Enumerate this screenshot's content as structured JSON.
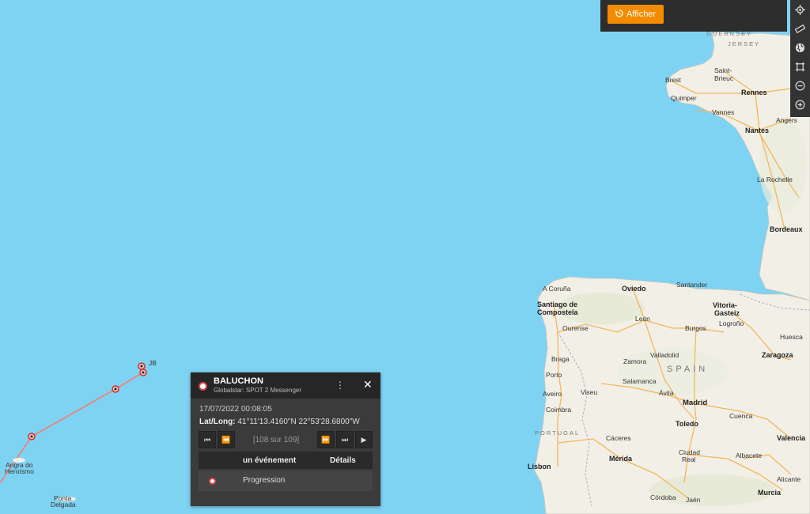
{
  "toolbar": {
    "afficher_label": "Afficher",
    "afficher_icon": "history-icon",
    "accent_color": "#f28b00"
  },
  "map_tools": [
    {
      "name": "locate-icon"
    },
    {
      "name": "ruler-icon"
    },
    {
      "name": "globe-icon"
    },
    {
      "name": "crop-icon"
    },
    {
      "name": "zoom-out-icon"
    },
    {
      "name": "zoom-in-icon"
    }
  ],
  "map": {
    "water_color": "#7fd3f2",
    "land_color": "#f2efe6",
    "track_color": "#e07a7a",
    "places": {
      "guernsey": "GUERNSEY",
      "jersey": "JERSEY",
      "saint_brieuc": "Saint-Brieuc",
      "brest": "Brest",
      "rennes": "Rennes",
      "quimper": "Quimper",
      "vannes": "Vannes",
      "angers": "Angers",
      "nantes": "Nantes",
      "la_rochelle": "La Rochelle",
      "bordeaux": "Bordeaux",
      "a_coruna": "A Coruña",
      "santiago": "Santiago de Compostela",
      "oviedo": "Oviedo",
      "santander": "Santander",
      "vitoria": "Vitoria-Gasteiz",
      "ourense": "Ourense",
      "leon": "León",
      "burgos": "Burgos",
      "logrono": "Logroño",
      "braga": "Braga",
      "porto": "Porto",
      "valladolid": "Valladolid",
      "zamora": "Zamora",
      "huesca": "Huesca",
      "zaragoza": "Zaragoza",
      "aveiro": "Aveiro",
      "viseu": "Viseu",
      "salamanca": "Salamanca",
      "avila": "Ávila",
      "coimbra": "Coimbra",
      "madrid": "Madrid",
      "cuenca": "Cuenca",
      "toledo": "Toledo",
      "valencia": "Valencia",
      "caceres": "Cáceres",
      "lisbon": "Lisbon",
      "merida": "Mérida",
      "ciudad_real": "Ciudad Real",
      "albacete": "Albacete",
      "alicante": "Alicante",
      "murcia": "Murcia",
      "cordoba": "Córdoba",
      "jaen": "Jaén",
      "angra": "Angra do Heroísmo",
      "ponta_delgada": "Ponta Delgada",
      "spain": "SPAIN",
      "portugal": "PORTUGAL",
      "marker_label": "JB"
    }
  },
  "popup": {
    "title": "BALUCHON",
    "subtitle": "Globalstar: SPOT 2 Messenger",
    "menu_icon": "more-vertical-icon",
    "close_icon": "close-icon",
    "date": "17/07/2022 00:08:05",
    "latlong_label": "Lat/Long:",
    "latlong_value": "41°11'13.4160\"N 22°53'28.6800\"W",
    "counter": "[108 sur 109]",
    "table_headers": {
      "event": "un événement",
      "details": "Détails"
    },
    "row": {
      "label": "Progression"
    }
  }
}
